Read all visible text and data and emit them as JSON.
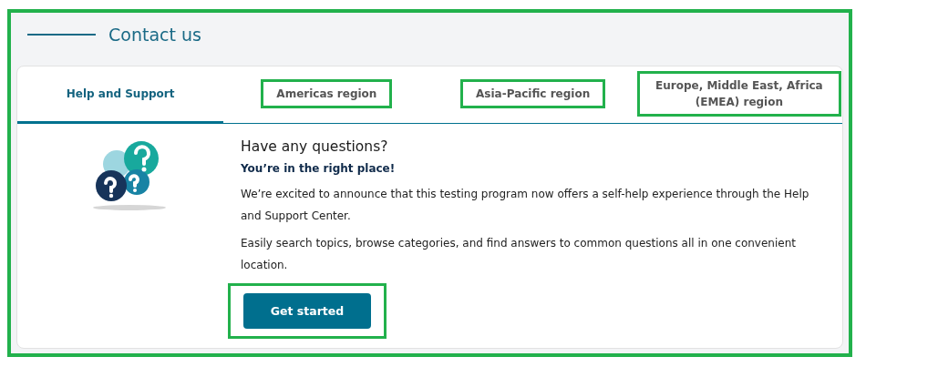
{
  "section": {
    "title": "Contact us",
    "highlighted": true
  },
  "tabs": [
    {
      "label": "Help and Support",
      "selected": true,
      "highlighted": false
    },
    {
      "label": "Americas region",
      "selected": false,
      "highlighted": true
    },
    {
      "label": "Asia-Pacific region",
      "selected": false,
      "highlighted": true
    },
    {
      "label": "Europe, Middle East, Africa (EMEA) region",
      "selected": false,
      "highlighted": true
    }
  ],
  "panel": {
    "heading": "Have any questions?",
    "subheading": "You’re in the right place!",
    "paragraphs": [
      "We’re excited to announce that this testing program now offers a self-help experience through the Help and Support Center.",
      "Easily search topics, browse categories, and find answers to common questions all in one convenient location."
    ],
    "button": {
      "label": "Get started",
      "highlighted": true
    }
  }
}
